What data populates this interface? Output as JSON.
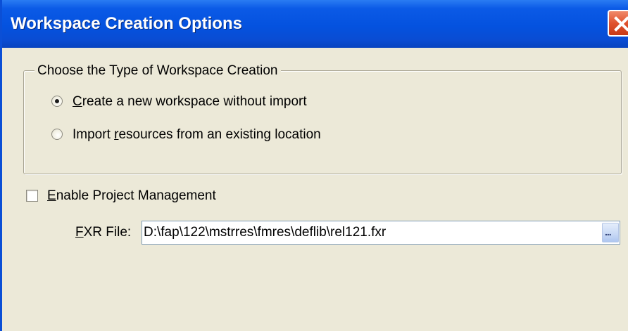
{
  "dialog": {
    "title": "Workspace Creation Options",
    "close_icon": "close-icon"
  },
  "workspace_type": {
    "legend": "Choose the Type of Workspace Creation",
    "options": [
      {
        "label_prefix": "",
        "accel": "C",
        "label_rest": "reate a new workspace without import",
        "selected": true
      },
      {
        "label_prefix": "Import ",
        "accel": "r",
        "label_rest": "esources from an existing location",
        "selected": false
      }
    ]
  },
  "project_management": {
    "accel": "E",
    "label_rest": "nable Project Management",
    "checked": false
  },
  "fxr": {
    "label_accel": "F",
    "label_rest": "XR File:",
    "value": "D:\\fap\\122\\mstrres\\fmres\\deflib\\rel121.fxr",
    "browse_label": "..."
  }
}
